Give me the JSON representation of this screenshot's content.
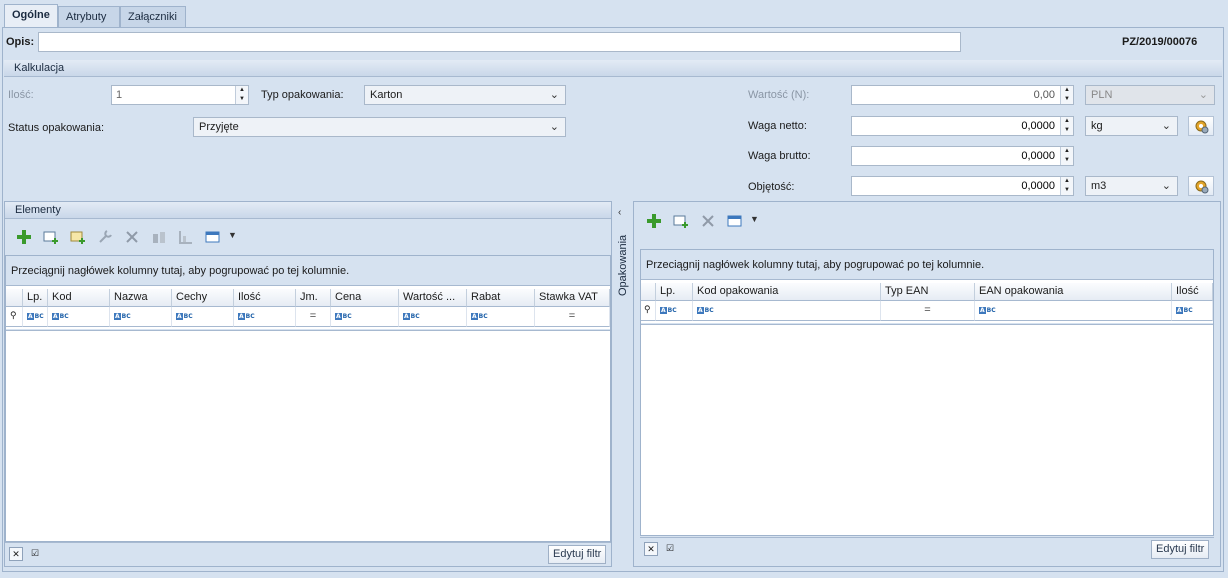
{
  "tabs": [
    "Ogólne",
    "Atrybuty",
    "Załączniki"
  ],
  "header": {
    "opis_label": "Opis:",
    "opis_value": "",
    "doc_number": "PZ/2019/00076"
  },
  "kalkulacja": {
    "title": "Kalkulacja",
    "ilosc_label": "Ilość:",
    "ilosc_value": "1",
    "typ_label": "Typ opakowania:",
    "typ_value": "Karton",
    "status_label": "Status opakowania:",
    "status_value": "Przyjęte",
    "wartosc_label": "Wartość (N):",
    "wartosc_value": "0,00",
    "currency": "PLN",
    "waga_netto_label": "Waga netto:",
    "waga_netto_value": "0,0000",
    "waga_netto_unit": "kg",
    "waga_brutto_label": "Waga brutto:",
    "waga_brutto_value": "0,0000",
    "objetosc_label": "Objętość:",
    "objetosc_value": "0,0000",
    "objetosc_unit": "m3"
  },
  "elementy": {
    "title": "Elementy",
    "group_hint": "Przeciągnij nagłówek kolumny tutaj, aby pogrupować po tej kolumnie.",
    "columns": [
      "Lp.",
      "Kod",
      "Nazwa",
      "Cechy",
      "Ilość",
      "Jm.",
      "Cena",
      "Wartość ...",
      "Rabat",
      "Stawka VAT"
    ],
    "filter_button": "Edytuj filtr"
  },
  "opakowania": {
    "side_label": "Opakowania",
    "group_hint": "Przeciągnij nagłówek kolumny tutaj, aby pogrupować po tej kolumnie.",
    "columns": [
      "Lp.",
      "Kod opakowania",
      "Typ EAN",
      "EAN opakowania",
      "Ilość"
    ],
    "filter_button": "Edytuj filtr"
  },
  "icons": {
    "add": "plus-icon",
    "add_from_list": "add-from-list-icon",
    "add_new": "add-new-icon",
    "edit": "wrench-icon",
    "delete": "delete-icon",
    "chevron": "chevron-left-icon"
  },
  "colors": {
    "accent": "#3d78bd",
    "add_green": "#3a9a2c",
    "background": "#d6e2f0"
  }
}
